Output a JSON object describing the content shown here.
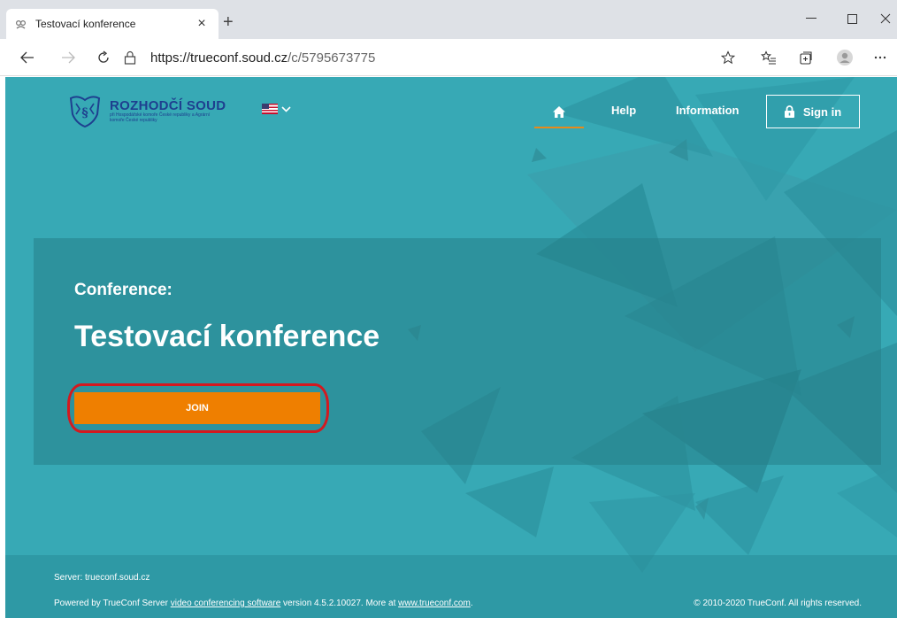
{
  "browser": {
    "tab_title": "Testovací konference",
    "url_host": "https://trueconf.soud.cz",
    "url_path": "/c/5795673775"
  },
  "header": {
    "org_name": "ROZHODČÍ SOUD",
    "org_sub": "při Hospodářské komoře České republiky a Agrární komoře České republiky",
    "nav_help": "Help",
    "nav_information": "Information",
    "signin_label": "Sign in"
  },
  "conference": {
    "label": "Conference:",
    "name": "Testovací konference",
    "join_label": "JOIN"
  },
  "footer": {
    "server": "Server: trueconf.soud.cz",
    "powered_prefix": "Powered by TrueConf Server ",
    "powered_link": "video conferencing software",
    "powered_middle": " version 4.5.2.10027. More at ",
    "powered_site": "www.trueconf.com",
    "powered_suffix": ".",
    "copyright": "© 2010-2020 TrueConf. All rights reserved."
  },
  "colors": {
    "page_bg": "#37a9b5",
    "join_button": "#ef7f00",
    "home_underline": "#e88a1a",
    "highlight_ring": "#d3191f",
    "logo_blue": "#1e3f8f"
  }
}
